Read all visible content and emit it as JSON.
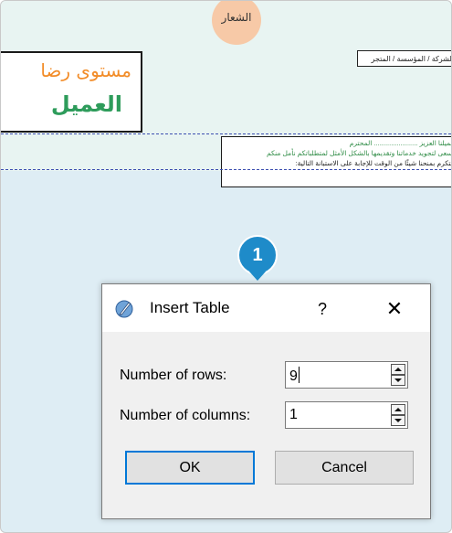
{
  "document": {
    "logo_text": "الشعار",
    "org_label": "الشركة / المؤسسة / المتجر",
    "title_line1": "مستوى رضا",
    "title_line2": "العميل",
    "intro_line1": "عميلنا العزيز ....................... المحترم",
    "intro_line2": "نسعى لتجويد خدماتنا وتقديمها بالشكل الأمثل لمتطلباتكم نأمل منكم",
    "intro_line3": "التكرم بمنحنا شيئًا من الوقت للإجابة على الاستبانة التالية:"
  },
  "callout": {
    "number": "1"
  },
  "dialog": {
    "title": "Insert Table",
    "help_label": "?",
    "close_label": "✕",
    "rows_label": "Number of rows:",
    "rows_value": "9",
    "columns_label": "Number of columns:",
    "columns_value": "1",
    "ok_label": "OK",
    "cancel_label": "Cancel"
  },
  "colors": {
    "title_orange": "#f28c28",
    "title_green": "#2e9c5b",
    "callout_blue": "#1e8bc9",
    "ok_focus": "#0078d7"
  },
  "icons": {
    "app": "writer-quill-icon",
    "spin_up": "arrow-up-icon",
    "spin_down": "arrow-down-icon"
  }
}
